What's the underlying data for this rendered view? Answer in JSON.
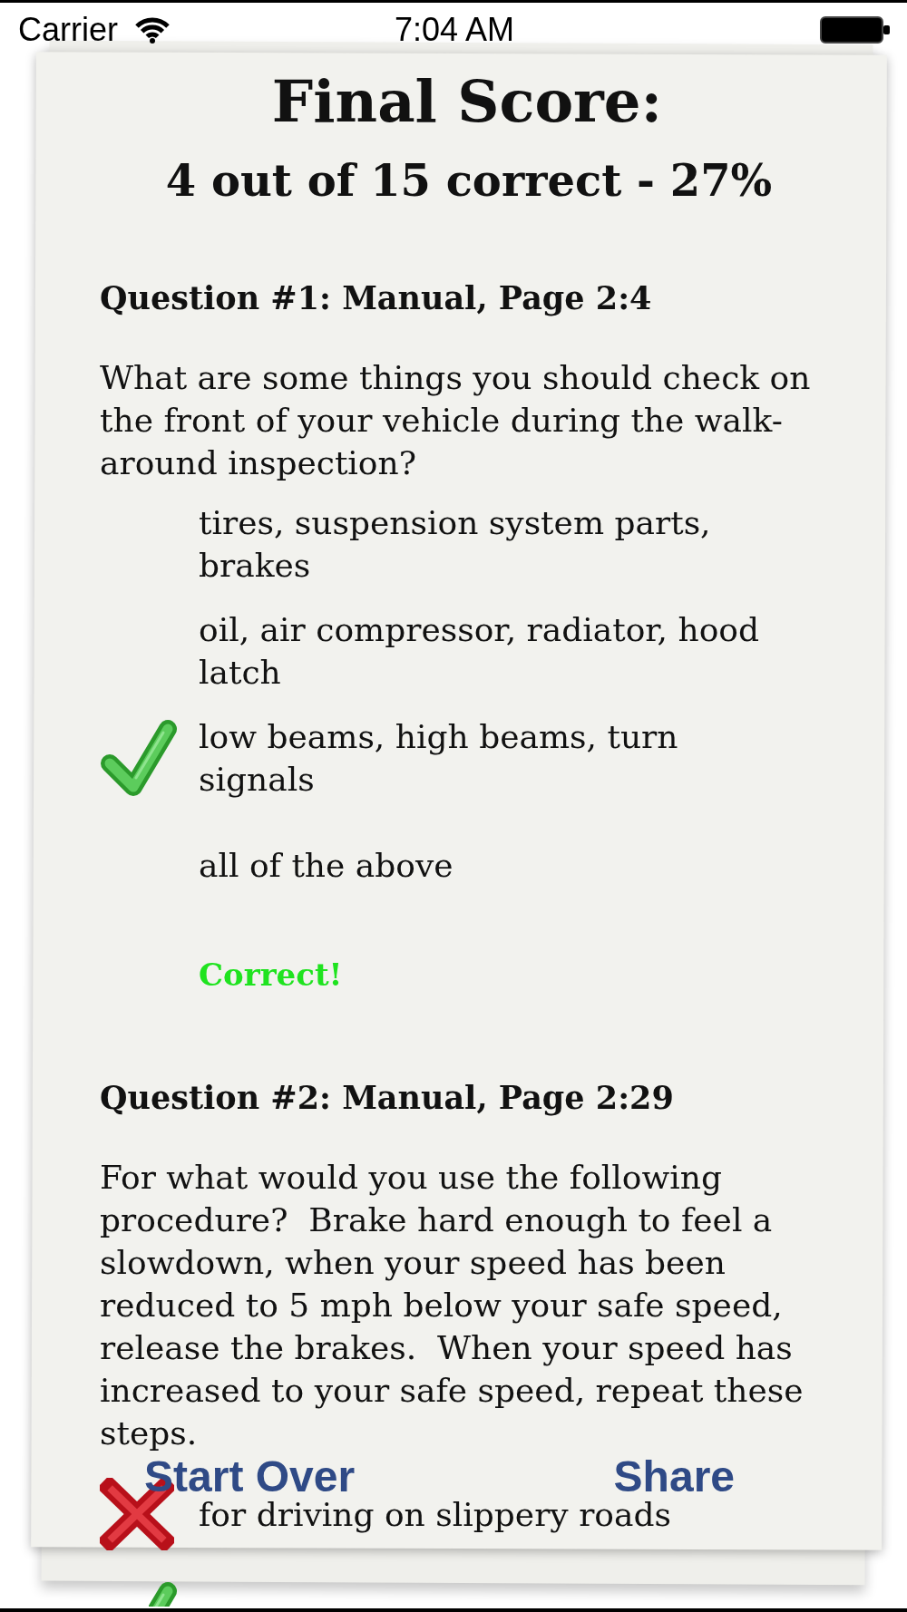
{
  "status_bar": {
    "carrier": "Carrier",
    "time": "7:04 AM"
  },
  "score": {
    "title": "Final Score:",
    "summary": "4 out of 15 correct - 27%"
  },
  "questions": [
    {
      "heading": "Question #1: Manual, Page 2:4",
      "text": "What are some things you should check on the front of your vehicle during the walk-around inspection?",
      "answers": [
        {
          "text": "tires, suspension system parts, brakes",
          "kind": "plain"
        },
        {
          "text": "oil, air compressor, radiator, hood latch",
          "kind": "plain"
        },
        {
          "text": "low beams, high beams, turn signals",
          "kind": "check"
        },
        {
          "text": "all of the above",
          "kind": "plain"
        }
      ],
      "result": {
        "kind": "correct",
        "text": "Correct!"
      }
    },
    {
      "heading": "Question #2: Manual, Page 2:29",
      "text": "For what would you use the following procedure?  Brake hard enough to feel a slowdown, when your speed has been reduced to 5 mph below your safe speed, release the brakes.  When your speed has increased to your safe speed, repeat these steps.",
      "answers": [
        {
          "text": "for driving on slippery roads",
          "kind": "cross"
        },
        {
          "kind": "check"
        }
      ]
    }
  ],
  "buttons": [
    {
      "label": "Start Over"
    },
    {
      "label": "Share"
    }
  ]
}
